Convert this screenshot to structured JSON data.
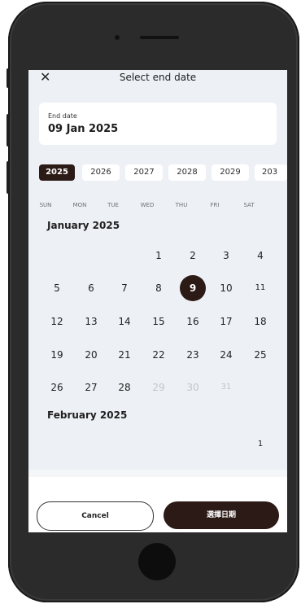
{
  "header": {
    "close_icon": "close-icon",
    "title": "Select end date"
  },
  "date_field": {
    "label": "End date",
    "value": "09 Jan 2025"
  },
  "years": [
    "2025",
    "2026",
    "2027",
    "2028",
    "2029",
    "203"
  ],
  "weekdays": [
    "SUN",
    "MON",
    "TUE",
    "WED",
    "THU",
    "FRI",
    "SAT"
  ],
  "months": [
    {
      "title": "January 2025",
      "weeks": [
        [
          "",
          "",
          "",
          "1",
          "2",
          "3",
          "4"
        ],
        [
          "5",
          "6",
          "7",
          "8",
          "9",
          "10",
          "11"
        ],
        [
          "12",
          "13",
          "14",
          "15",
          "16",
          "17",
          "18"
        ],
        [
          "19",
          "20",
          "21",
          "22",
          "23",
          "24",
          "25"
        ],
        [
          "26",
          "27",
          "28",
          "29",
          "30",
          "31",
          ""
        ]
      ],
      "selected_day": "9",
      "disabled_days": [
        "29",
        "30",
        "31"
      ]
    },
    {
      "title": "February 2025",
      "weeks": [
        [
          "",
          "",
          "",
          "",
          "",
          "",
          "1"
        ]
      ]
    }
  ],
  "actions": {
    "cancel_label": "Cancel",
    "confirm_label": "選擇日期"
  },
  "colors": {
    "accent": "#2b1a15",
    "screen_bg": "#edf0f5"
  }
}
